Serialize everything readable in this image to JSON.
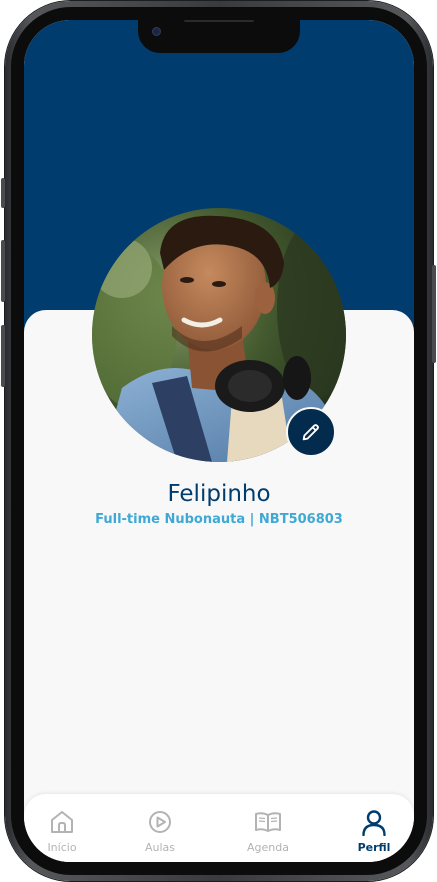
{
  "profile": {
    "name": "Felipinho",
    "subtitle": "Full-time Nubonauta | NBT506803"
  },
  "tabs": [
    {
      "label": "Início",
      "icon": "home-icon",
      "active": false
    },
    {
      "label": "Aulas",
      "icon": "play-circle-icon",
      "active": false
    },
    {
      "label": "Agenda",
      "icon": "open-book-icon",
      "active": false
    },
    {
      "label": "Perfil",
      "icon": "user-icon",
      "active": true
    }
  ],
  "colors": {
    "header": "#003d6e",
    "accent": "#3fa9d6",
    "edit_button": "#032b4d",
    "tab_inactive": "#b3b3b3",
    "tab_active": "#003d6e"
  }
}
